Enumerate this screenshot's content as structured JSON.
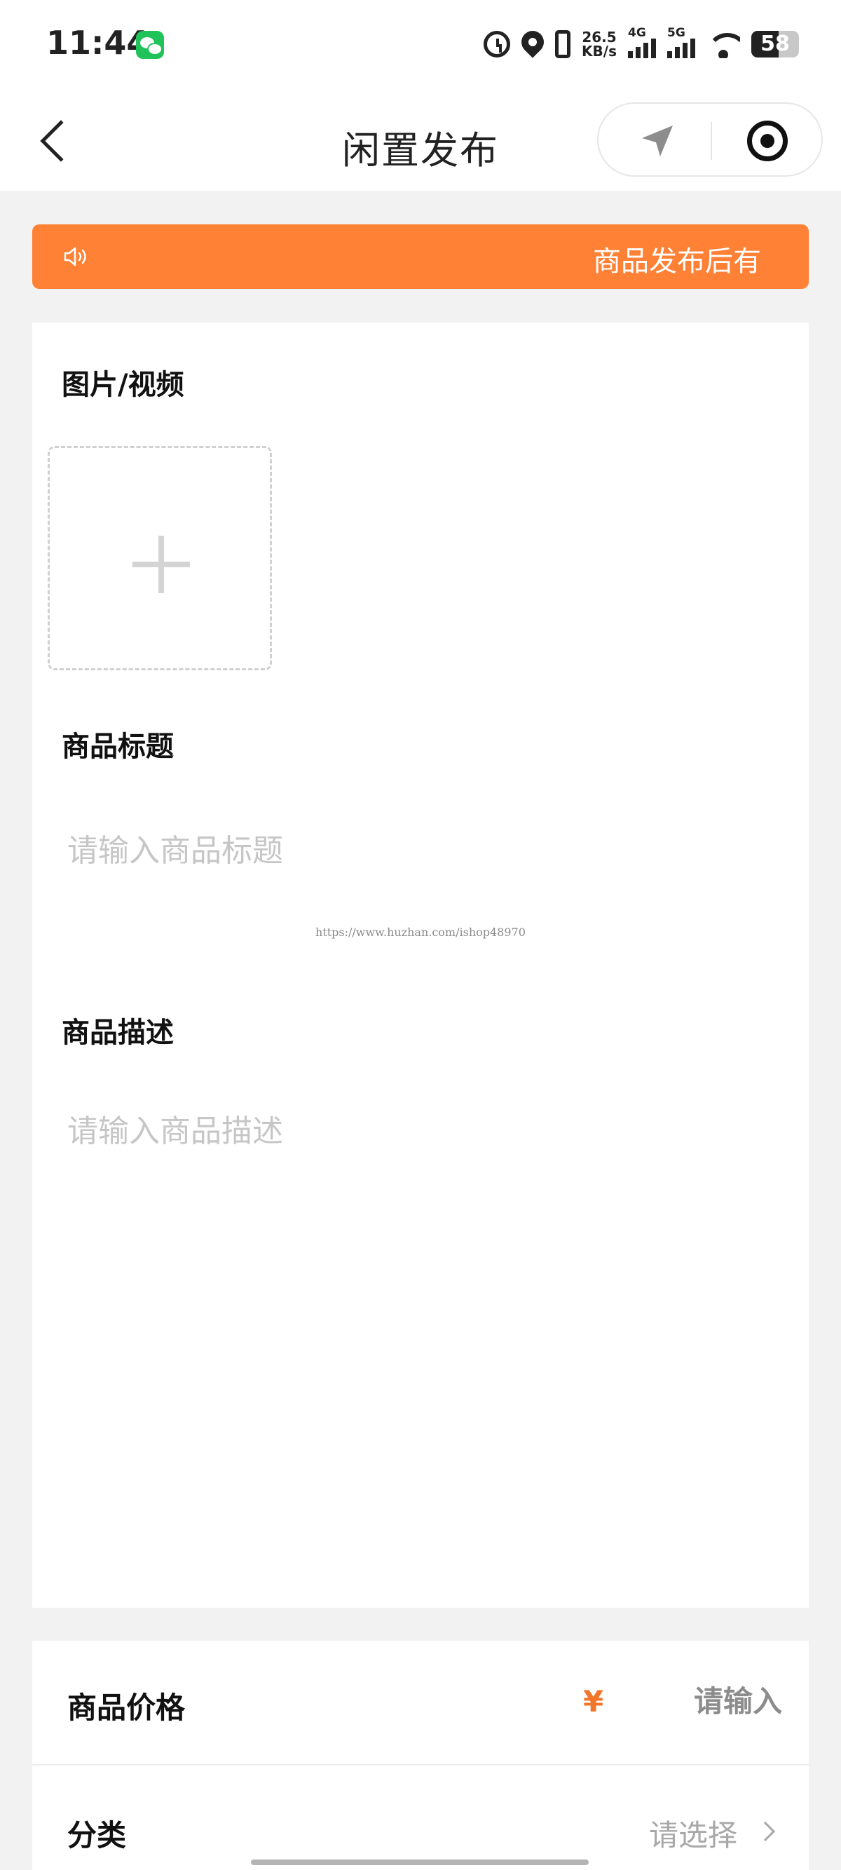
{
  "status_bar": {
    "time": "11:44",
    "speed_value": "26.5",
    "speed_unit": "KB/s",
    "signal_4g": "4G",
    "signal_5g": "5G",
    "battery": "58",
    "battery_level": 0.58,
    "icons": [
      "wechat-icon",
      "alarm-icon",
      "location-pin-icon",
      "vibrate-icon",
      "signal-icon",
      "wifi-icon",
      "battery-icon"
    ]
  },
  "nav": {
    "title": "闲置发布",
    "icons": [
      "back-icon",
      "location-arrow-icon",
      "target-icon"
    ]
  },
  "notice": {
    "text": "商品发布后有",
    "icon": "speaker-icon",
    "background": "#fe8136"
  },
  "form": {
    "media_label": "图片/视频",
    "title_label": "商品标题",
    "title_placeholder": "请输入商品标题",
    "watermark": "https://www.huzhan.com/ishop48970",
    "desc_label": "商品描述",
    "desc_placeholder": "请输入商品描述",
    "price_label": "商品价格",
    "currency_symbol": "¥",
    "price_placeholder": "请输入",
    "category_label": "分类",
    "category_value": "请选择"
  },
  "colors": {
    "accent": "#fe8136",
    "currency": "#f0762c",
    "page_background": "#f2f2f2"
  }
}
